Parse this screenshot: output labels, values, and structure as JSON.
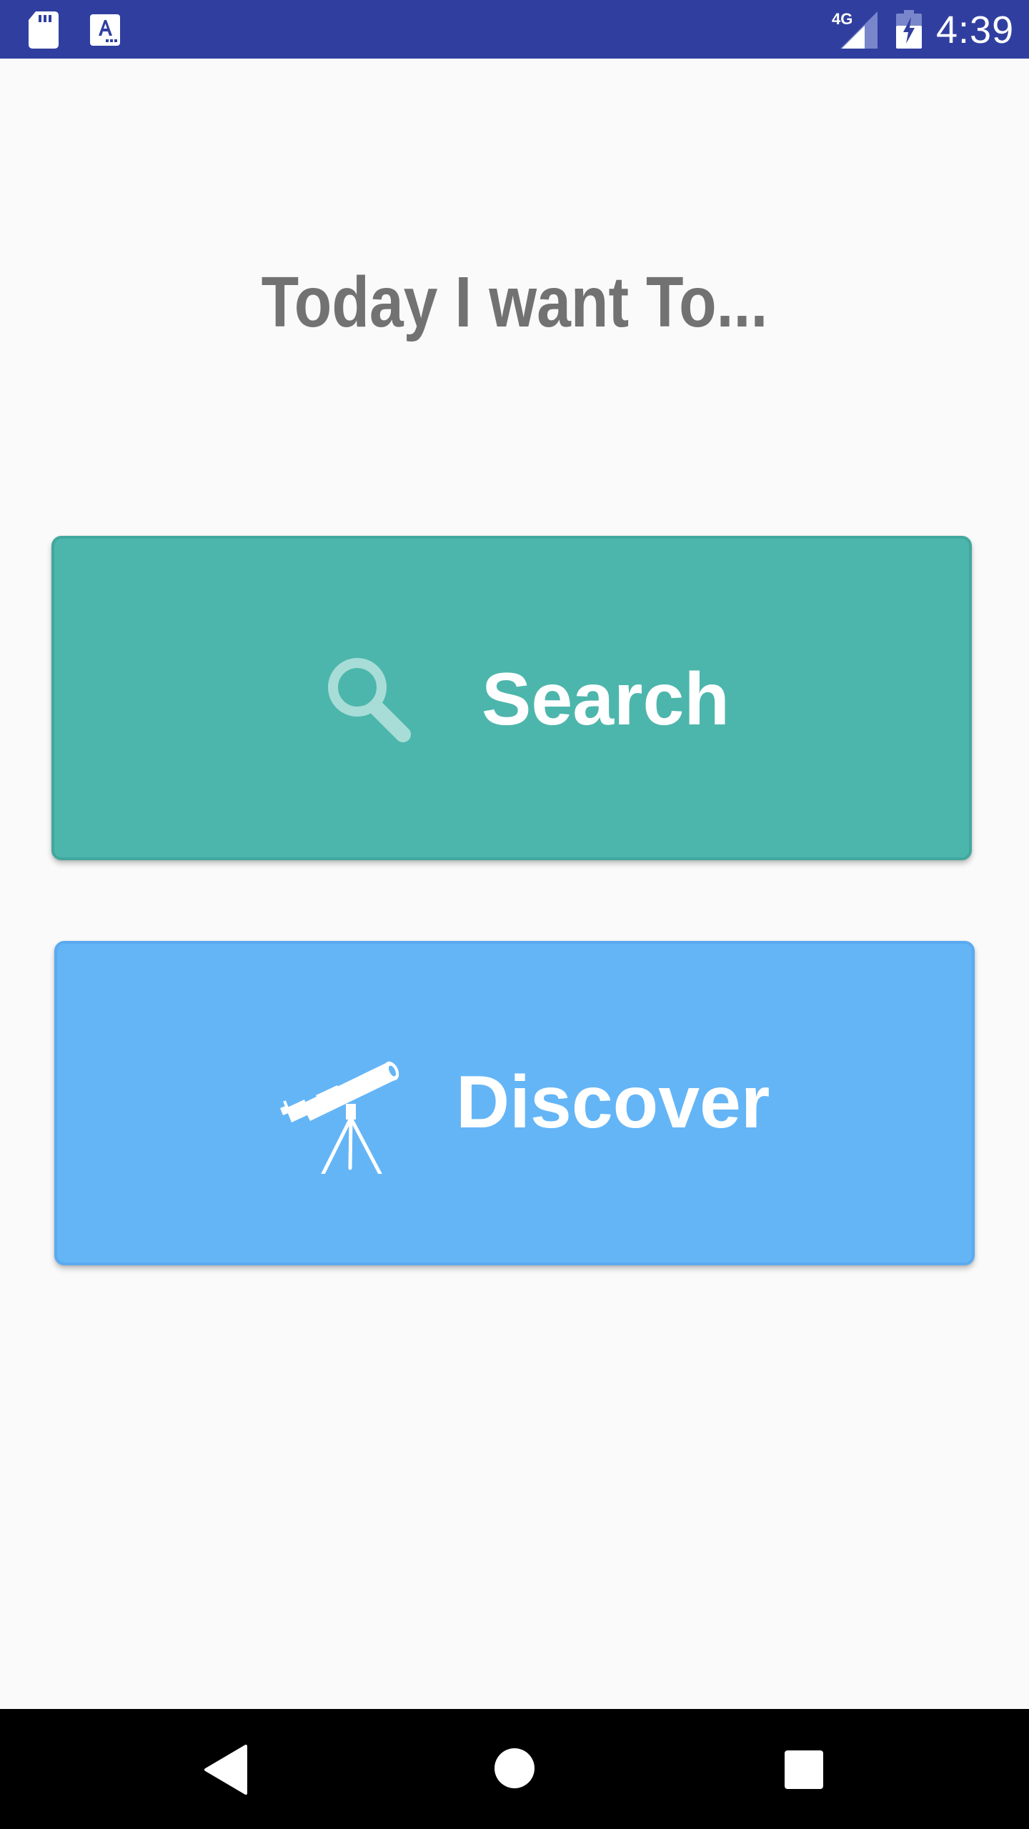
{
  "status_bar": {
    "time": "4:39",
    "network_label": "4G",
    "icons": [
      "sd-card-icon",
      "text-a-icon",
      "cell-signal-4g-icon",
      "battery-charging-icon"
    ],
    "background_color": "#303f9f"
  },
  "main": {
    "title": "Today I want To...",
    "search_button": {
      "label": "Search",
      "icon": "magnifier-icon",
      "color": "#4db6ac"
    },
    "discover_button": {
      "label": "Discover",
      "icon": "telescope-icon",
      "color": "#64b5f6"
    }
  },
  "nav_bar": {
    "buttons": [
      "back-icon",
      "home-icon",
      "recents-icon"
    ]
  }
}
